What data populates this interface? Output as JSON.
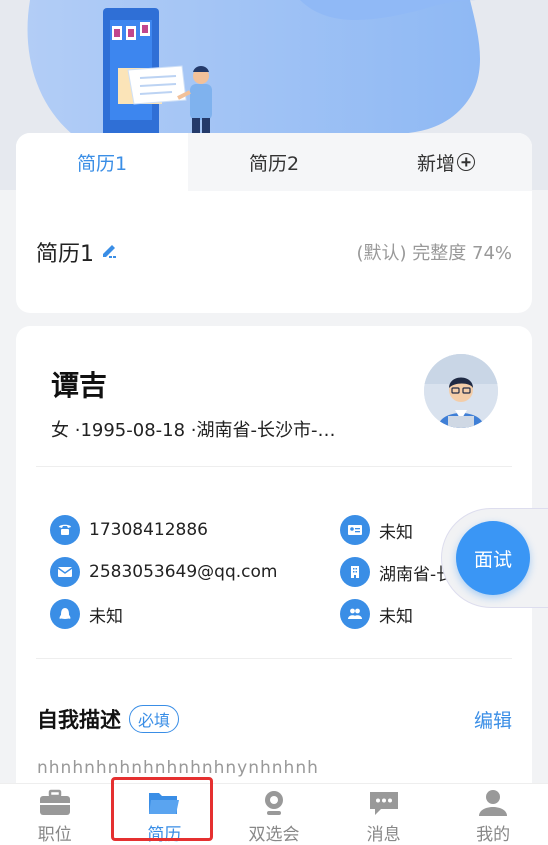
{
  "resume_tabs": [
    {
      "label": "简历1",
      "active": true
    },
    {
      "label": "简历2",
      "active": false
    },
    {
      "label": "新增",
      "active": false
    }
  ],
  "resume_row": {
    "name": "简历1",
    "meta": "(默认) 完整度 74%"
  },
  "profile": {
    "name": "谭吉",
    "info": "女 ·1995-08-18 ·湖南省-长沙市-…",
    "contacts": {
      "phone": "17308412886",
      "id_card": "未知",
      "email": "2583053649@qq.com",
      "address": "湖南省-长",
      "qq": "未知",
      "marital": "未知"
    }
  },
  "self_desc": {
    "title": "自我描述",
    "required": "必填",
    "edit": "编辑",
    "content": "nhnhnhnhnhnhnhnhnynhnhnh"
  },
  "float_button": "面试",
  "tabbar": [
    {
      "label": "职位",
      "icon": "briefcase-icon"
    },
    {
      "label": "简历",
      "icon": "folder-icon",
      "active": true
    },
    {
      "label": "双选会",
      "icon": "webcam-icon"
    },
    {
      "label": "消息",
      "icon": "chat-icon"
    },
    {
      "label": "我的",
      "icon": "person-icon"
    }
  ],
  "colors": {
    "accent": "#3a8ee6",
    "highlight": "#e53030",
    "bg": "#f2f3f5"
  }
}
